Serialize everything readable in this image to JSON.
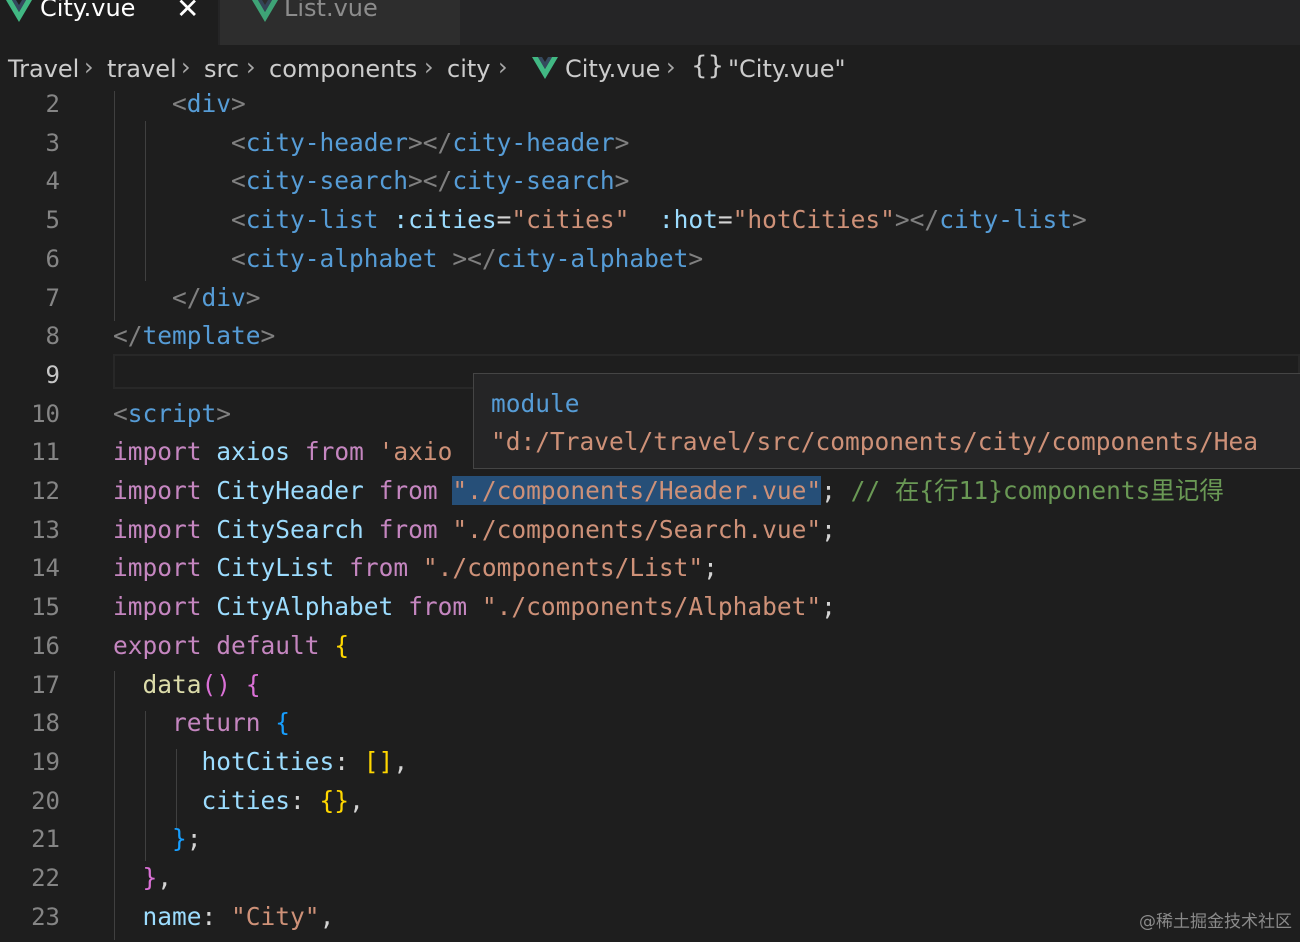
{
  "tabs": [
    {
      "label": "City.vue",
      "active": true,
      "icon": "vue-icon"
    },
    {
      "label": "List.vue",
      "active": false,
      "icon": "vue-icon"
    }
  ],
  "breadcrumb": {
    "items": [
      "Travel",
      "travel",
      "src",
      "components",
      "city"
    ],
    "file": "City.vue",
    "symbol_icon": "{}",
    "symbol": "\"City.vue\""
  },
  "line_numbers": [
    "2",
    "3",
    "4",
    "5",
    "6",
    "7",
    "8",
    "9",
    "10",
    "11",
    "12",
    "13",
    "14",
    "15",
    "16",
    "17",
    "18",
    "19",
    "20",
    "21",
    "22",
    "23"
  ],
  "code": {
    "l2": {
      "open": "<",
      "tag": "div",
      "close": ">"
    },
    "l3": {
      "tag": "city-header",
      "end_tag": "city-header"
    },
    "l4": {
      "tag": "city-search",
      "end_tag": "city-search"
    },
    "l5": {
      "tag": "city-list",
      "attr1": ":cities",
      "val1": "\"cities\"",
      "attr2": ":hot",
      "val2": "\"hotCities\"",
      "end_tag": "city-list"
    },
    "l6": {
      "tag": "city-alphabet",
      "end_tag": "city-alphabet"
    },
    "l7": {
      "end_tag": "div"
    },
    "l8": {
      "end_tag": "template"
    },
    "l10": {
      "tag": "script"
    },
    "l11": {
      "kw": "import",
      "name": "axios",
      "from": "from",
      "src": "'axio"
    },
    "l12": {
      "kw": "import",
      "name": "CityHeader",
      "from": "from",
      "src": "\"./components/Header.vue\"",
      "comment": "// 在{行11}components里记得"
    },
    "l13": {
      "kw": "import",
      "name": "CitySearch",
      "from": "from",
      "src": "\"./components/Search.vue\""
    },
    "l14": {
      "kw": "import",
      "name": "CityList",
      "from": "from",
      "src": "\"./components/List\""
    },
    "l15": {
      "kw": "import",
      "name": "CityAlphabet",
      "from": "from",
      "src": "\"./components/Alphabet\""
    },
    "l16": {
      "kw1": "export",
      "kw2": "default"
    },
    "l17": {
      "fn": "data"
    },
    "l18": {
      "kw": "return"
    },
    "l19": {
      "prop": "hotCities"
    },
    "l20": {
      "prop": "cities"
    },
    "l23": {
      "prop": "name",
      "val": "\"City\""
    }
  },
  "hover": {
    "kind": "module",
    "path": "\"d:/Travel/travel/src/components/city/components/Hea"
  },
  "watermark": "@稀土掘金技术社区",
  "colors": {
    "bg": "#1e1e1e",
    "tag": "#569cd6",
    "string": "#ce9178",
    "keyword": "#c586c0",
    "variable": "#9cdcfe",
    "comment": "#6a9955"
  }
}
